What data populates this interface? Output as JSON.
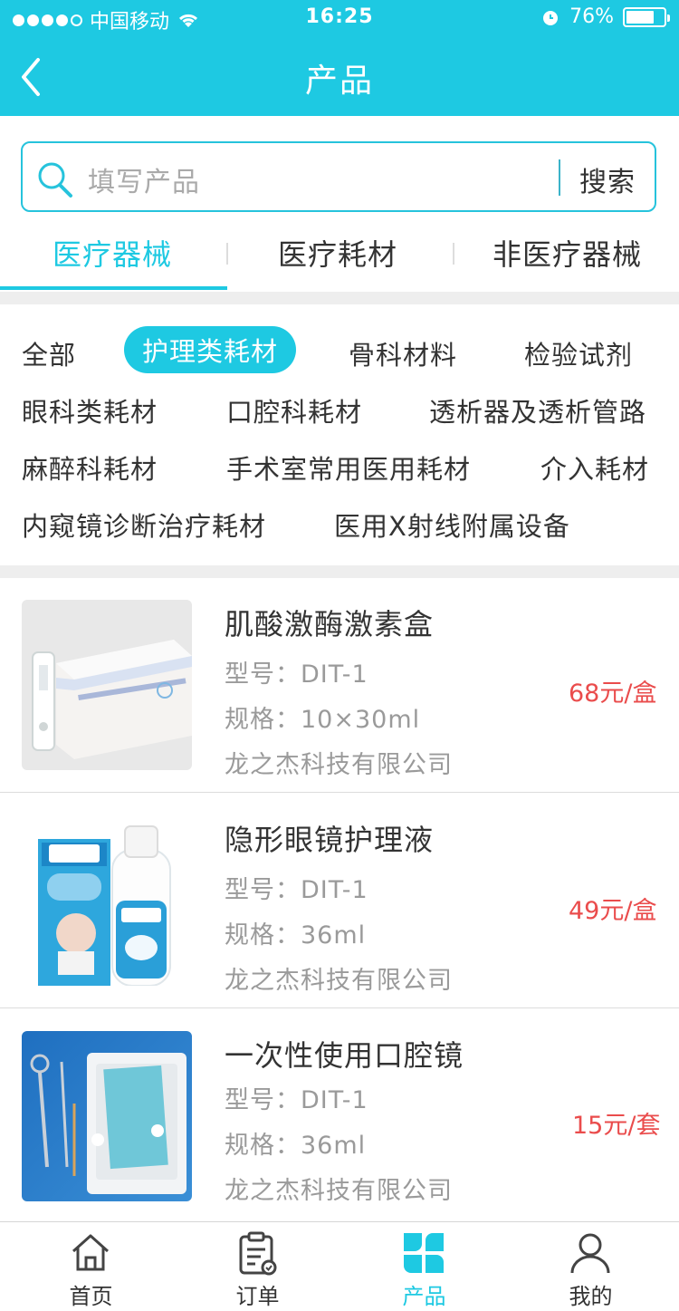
{
  "status_bar": {
    "carrier": "中国移动",
    "time": "16:25",
    "battery": "76%",
    "battery_level": 0.76
  },
  "header": {
    "title": "产品"
  },
  "search": {
    "placeholder": "填写产品",
    "button": "搜索"
  },
  "tabs": [
    {
      "label": "医疗器械",
      "active": true
    },
    {
      "label": "医疗耗材",
      "active": false
    },
    {
      "label": "非医疗器械",
      "active": false
    }
  ],
  "categories": [
    "全部",
    "护理类耗材",
    "骨科材料",
    "检验试剂",
    "眼科类耗材",
    "口腔科耗材",
    "透析器及透析管路",
    "麻醉科耗材",
    "手术室常用医用耗材",
    "介入耗材",
    "内窥镜诊断治疗耗材",
    "医用X射线附属设备"
  ],
  "active_category": "护理类耗材",
  "products": [
    {
      "name": "肌酸激酶激素盒",
      "model": "型号：DIT-1",
      "spec": "规格：10×30ml",
      "company": "龙之杰科技有限公司",
      "price": "68元/盒"
    },
    {
      "name": "隐形眼镜护理液",
      "model": "型号：DIT-1",
      "spec": "规格：36ml",
      "company": "龙之杰科技有限公司",
      "price": "49元/盒"
    },
    {
      "name": "一次性使用口腔镜",
      "model": "型号：DIT-1",
      "spec": "规格：36ml",
      "company": "龙之杰科技有限公司",
      "price": "15元/套"
    }
  ],
  "tabbar": [
    {
      "label": "首页",
      "icon": "home-icon",
      "active": false
    },
    {
      "label": "订单",
      "icon": "order-icon",
      "active": false
    },
    {
      "label": "产品",
      "icon": "product-icon",
      "active": true
    },
    {
      "label": "我的",
      "icon": "profile-icon",
      "active": false
    }
  ],
  "colors": {
    "accent": "#1ec9e2",
    "price": "#ea4c4c"
  }
}
